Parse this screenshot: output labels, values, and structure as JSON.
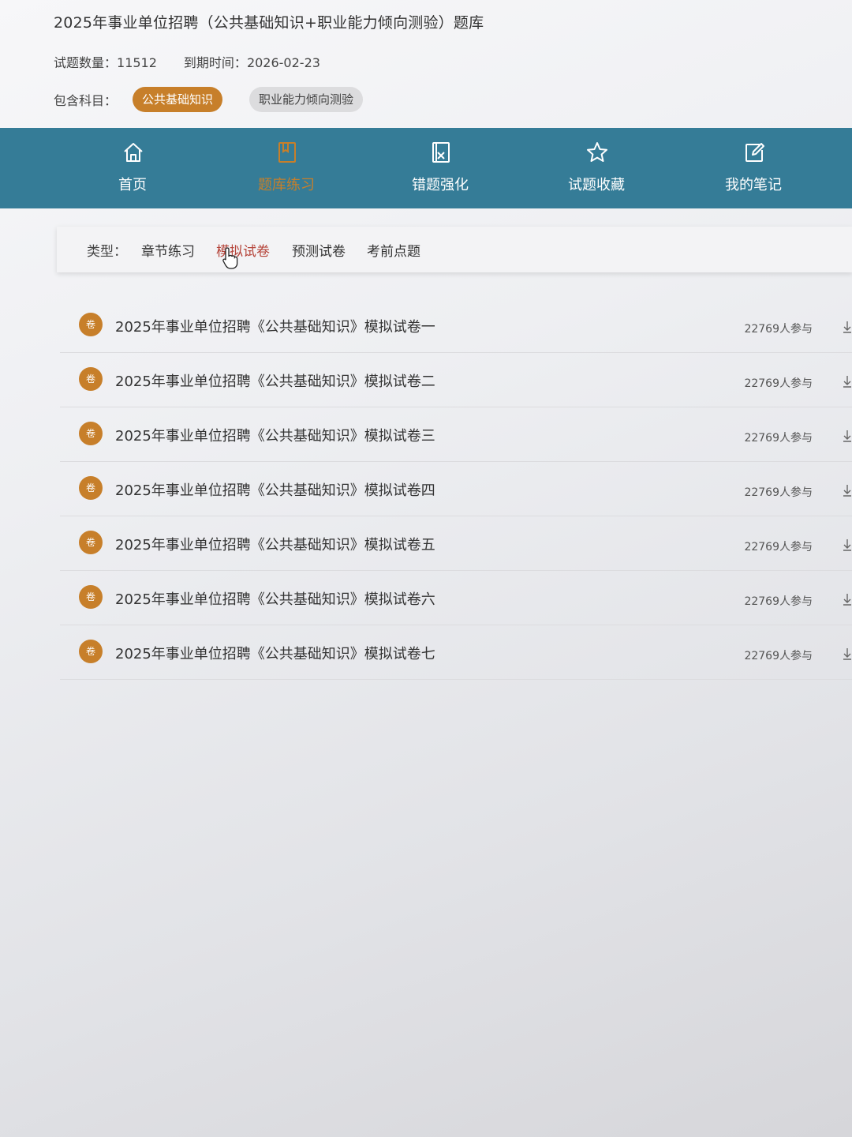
{
  "header": {
    "title": "2025年事业单位招聘（公共基础知识+职业能力倾向测验）题库",
    "question_count_label": "试题数量：",
    "question_count": "11512",
    "expiry_label": "到期时间：",
    "expiry_date": "2026-02-23",
    "subjects_label": "包含科目：",
    "subjects": [
      {
        "label": "公共基础知识",
        "active": true
      },
      {
        "label": "职业能力倾向测验",
        "active": false
      }
    ]
  },
  "nav": {
    "items": [
      {
        "label": "首页",
        "icon": "home-icon"
      },
      {
        "label": "题库练习",
        "icon": "book-icon",
        "active": true
      },
      {
        "label": "错题强化",
        "icon": "wrong-question-icon"
      },
      {
        "label": "试题收藏",
        "icon": "star-icon"
      },
      {
        "label": "我的笔记",
        "icon": "edit-note-icon"
      }
    ]
  },
  "filter": {
    "label": "类型：",
    "options": [
      "章节练习",
      "模拟试卷",
      "预测试卷",
      "考前点题"
    ],
    "active": "模拟试卷"
  },
  "papers": {
    "badge": "卷",
    "items": [
      {
        "title": "2025年事业单位招聘《公共基础知识》模拟试卷一",
        "participants": "22769人参与"
      },
      {
        "title": "2025年事业单位招聘《公共基础知识》模拟试卷二",
        "participants": "22769人参与"
      },
      {
        "title": "2025年事业单位招聘《公共基础知识》模拟试卷三",
        "participants": "22769人参与"
      },
      {
        "title": "2025年事业单位招聘《公共基础知识》模拟试卷四",
        "participants": "22769人参与"
      },
      {
        "title": "2025年事业单位招聘《公共基础知识》模拟试卷五",
        "participants": "22769人参与"
      },
      {
        "title": "2025年事业单位招聘《公共基础知识》模拟试卷六",
        "participants": "22769人参与"
      },
      {
        "title": "2025年事业单位招聘《公共基础知识》模拟试卷七",
        "participants": "22769人参与"
      }
    ]
  },
  "colors": {
    "nav_background": "#357c97",
    "accent": "#c77f2a",
    "active_filter": "#b5443a"
  }
}
